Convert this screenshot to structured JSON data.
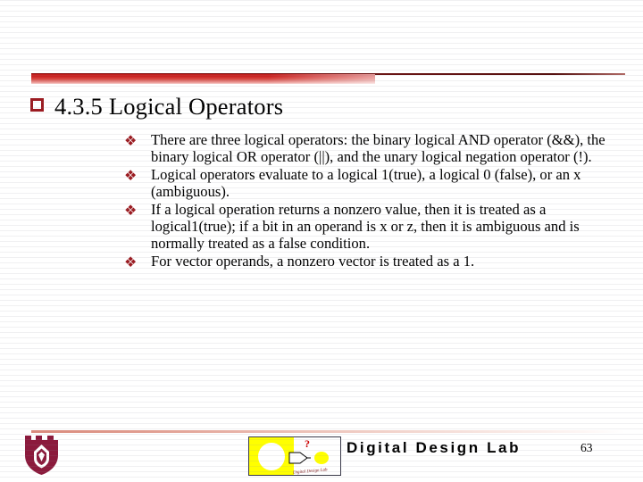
{
  "slide": {
    "title": "4.3.5 Logical Operators",
    "title_bullet_icon": "square-outline-bullet",
    "page_number": "63",
    "bullets": [
      {
        "marker_icon": "diamond-cluster-bullet",
        "marker_glyph": "❖",
        "text": "There are three logical operators: the binary logical AND operator (&&), the binary logical OR operator (||), and the unary logical negation operator (!)."
      },
      {
        "marker_icon": "diamond-cluster-bullet",
        "marker_glyph": "❖",
        "text": "Logical operators evaluate to a logical 1(true), a logical 0 (false), or an x (ambiguous)."
      },
      {
        "marker_icon": "diamond-cluster-bullet",
        "marker_glyph": "❖",
        "text": "If a logical operation returns a nonzero value, then it is treated as a logical1(true); if a bit in an operand is x or z, then it is ambiguous and is normally treated as a false condition."
      },
      {
        "marker_icon": "diamond-cluster-bullet",
        "marker_glyph": "❖",
        "text": "For vector operands, a nonzero vector is treated as a 1."
      }
    ]
  },
  "footer": {
    "wordmark": "Digital Design Lab",
    "logo_microtext": "Digital Design Lab",
    "logo_question_mark": "?",
    "crest_icon": "university-shield-crest",
    "logo_icon": "digital-design-lab-logo"
  },
  "colors": {
    "accent_dark_red": "#9b1b21",
    "accent_bright_red": "#c21a18",
    "crest_maroon": "#8b1a3c",
    "logo_yellow": "#ffff00",
    "background": "#ffffff",
    "text": "#000000"
  }
}
